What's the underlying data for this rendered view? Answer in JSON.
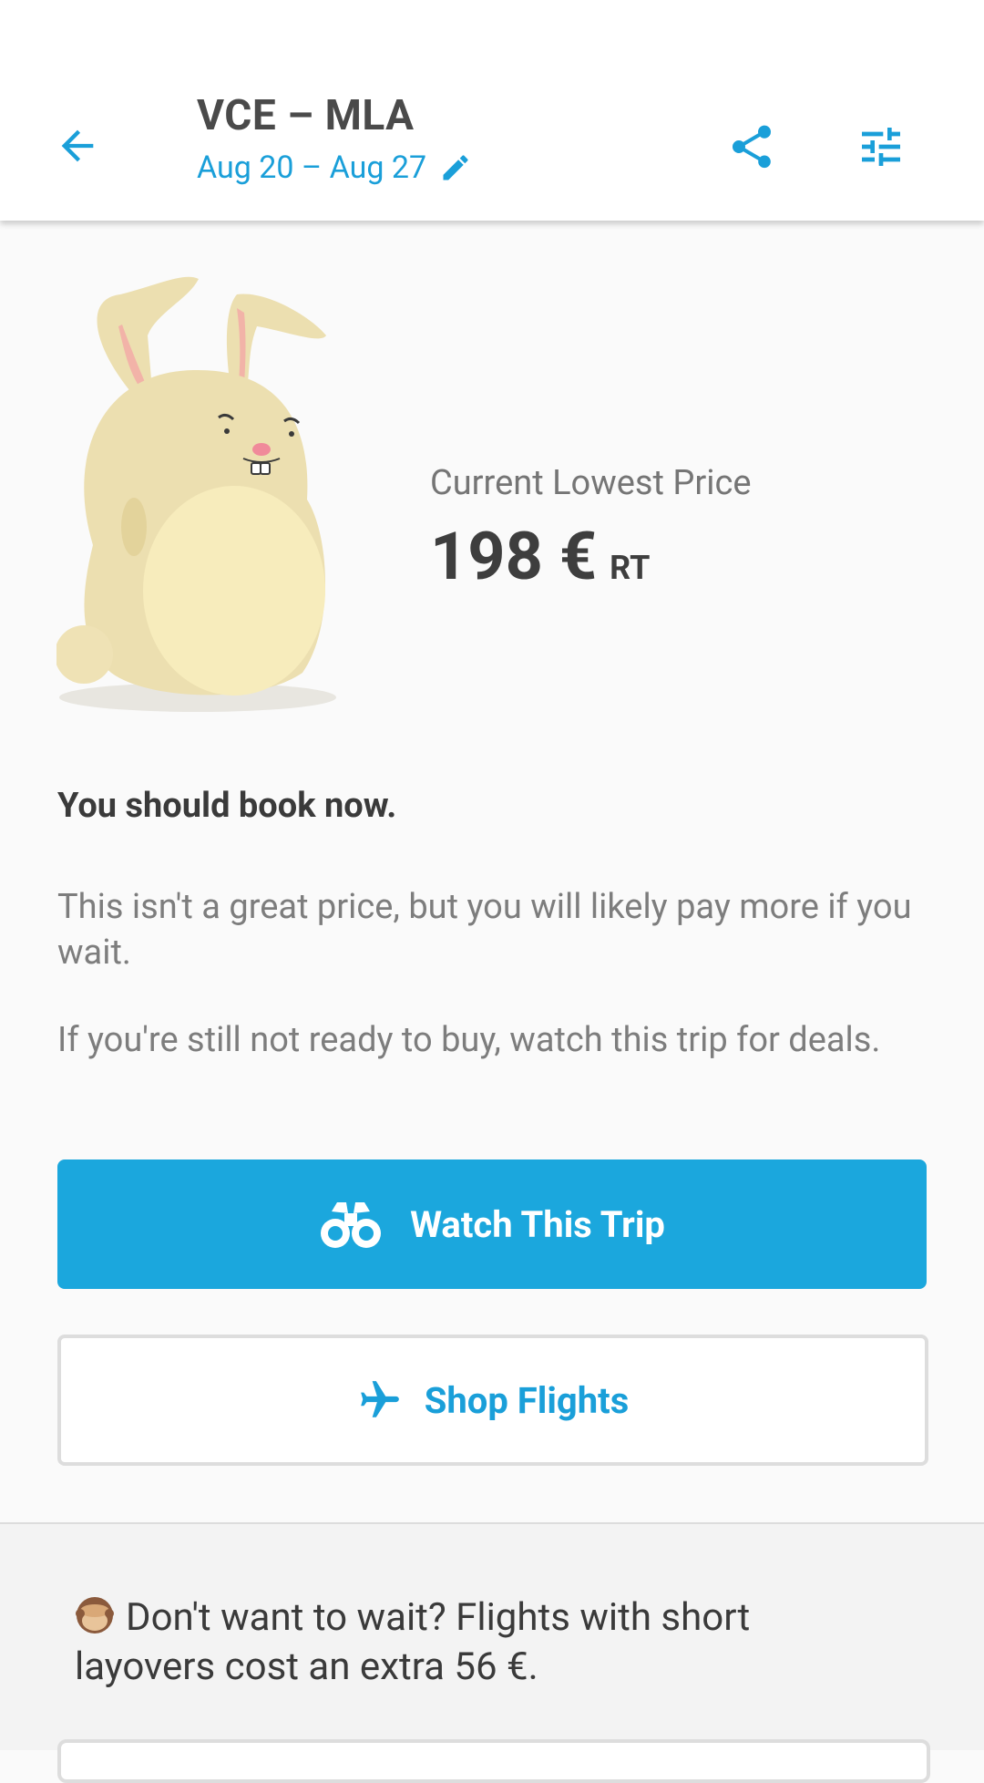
{
  "header": {
    "route": "VCE – MLA",
    "dates": "Aug 20 – Aug 27",
    "icons": {
      "back": "arrow-left-icon",
      "edit": "pencil-icon",
      "share": "share-icon",
      "filter": "tune-icon"
    }
  },
  "price": {
    "label": "Current Lowest Price",
    "value": "198 €",
    "suffix": "RT"
  },
  "advice": {
    "headline": "You should book now.",
    "detail": "This isn't a great price, but you will likely pay more if you wait.",
    "watch_hint": "If you're still not ready to buy, watch this trip for deals."
  },
  "actions": {
    "watch_label": "Watch This Trip",
    "shop_label": "Shop Flights"
  },
  "layover_note": {
    "text": "Don't want to wait? Flights with short layovers cost an extra 56 €."
  },
  "colors": {
    "accent": "#1ba7dd",
    "text_dark": "#3a3a3a",
    "text_muted": "#7d7d7d"
  }
}
